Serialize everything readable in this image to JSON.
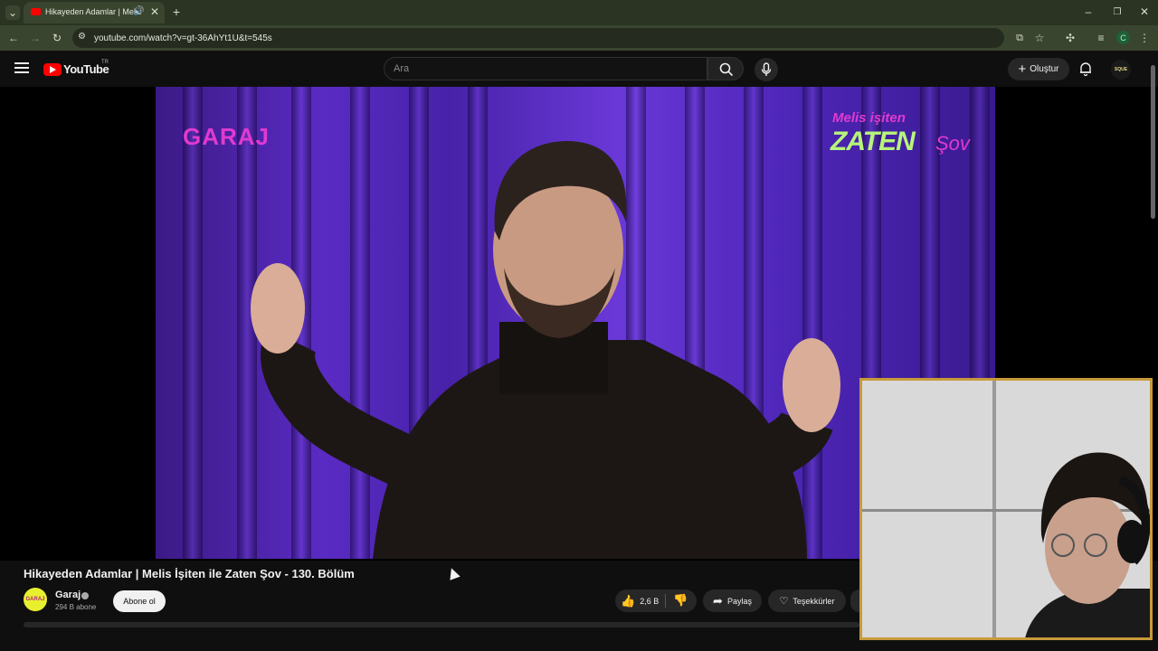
{
  "browser": {
    "tab_title": "Hikayeden Adamlar | Melis",
    "url": "youtube.com/watch?v=gt-36AhYt1U&t=545s",
    "profile_initial": "C"
  },
  "youtube": {
    "logo_text": "YouTube",
    "region": "TR",
    "search_placeholder": "Ara",
    "create_label": "Oluştur",
    "account_label": "SQUE"
  },
  "video_overlay": {
    "left_logo": "GARAJ",
    "right_logo_top": "Melis işiten",
    "right_logo_main": "ZATEN",
    "right_logo_sub": "Şov"
  },
  "video_info": {
    "title": "Hikayeden Adamlar | Melis İşiten ile Zaten Şov - 130. Bölüm",
    "channel_name": "Garaj",
    "avatar_text": "GARAJ",
    "subscribers": "294 B abone",
    "subscribe_label": "Abone ol",
    "like_count": "2,6 B",
    "share_label": "Paylaş",
    "thanks_label": "Teşekkürler"
  },
  "colors": {
    "tab_bg": "#2b3322",
    "toolbar_bg": "#3a4530",
    "yt_red": "#ff0000",
    "garaj_magenta": "#e03ad0",
    "zaten_green": "#b7f57a",
    "webcam_border": "#c79a3a"
  }
}
